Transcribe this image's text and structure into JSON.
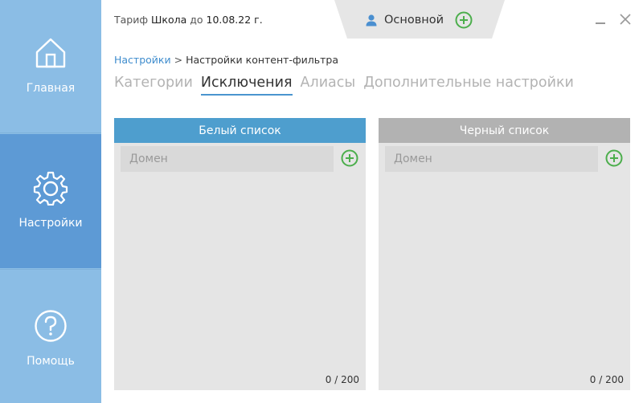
{
  "sidebar": {
    "items": [
      {
        "id": "home",
        "label": "Главная",
        "icon": "home-icon",
        "active": false
      },
      {
        "id": "settings",
        "label": "Настройки",
        "icon": "gear-icon",
        "active": true
      },
      {
        "id": "help",
        "label": "Помощь",
        "icon": "help-icon",
        "active": false
      }
    ]
  },
  "header": {
    "plan_prefix": "Тариф",
    "plan_name": "Школа",
    "plan_until": "до",
    "plan_date": "10.08.22 г.",
    "profile_name": "Основной"
  },
  "breadcrumb": {
    "root": "Настройки",
    "separator": ">",
    "current": "Настройки контент-фильтра"
  },
  "tabs": [
    {
      "label": "Категории",
      "active": false
    },
    {
      "label": "Исключения",
      "active": true
    },
    {
      "label": "Алиасы",
      "active": false
    },
    {
      "label": "Дополнительные настройки",
      "active": false
    }
  ],
  "whitelist": {
    "title": "Белый список",
    "placeholder": "Домен",
    "counter": "0 / 200"
  },
  "blacklist": {
    "title": "Черный список",
    "placeholder": "Домен",
    "counter": "0 / 200"
  },
  "colors": {
    "accent": "#4e9ece",
    "sidebar": "#8bbde5",
    "sidebar_active": "#5d9ad5",
    "add_green": "#4cae4c"
  }
}
